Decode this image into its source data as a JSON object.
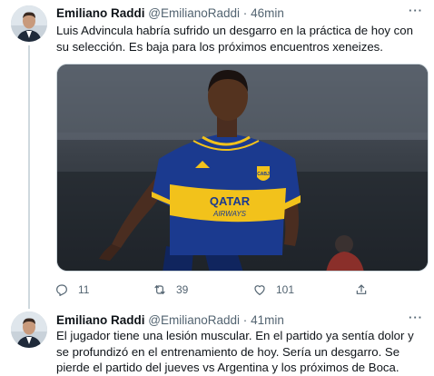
{
  "tweets": [
    {
      "name": "Emiliano Raddi",
      "handle": "@EmilianoRaddi",
      "separator": "·",
      "time": "46min",
      "more": "···",
      "text": "Luis Advincula habría sufrido un desgarro en la práctica de hoy con su selección. Es baja para los próximos encuentros xeneizes.",
      "media": {
        "jersey_sponsor_line1": "QATAR",
        "jersey_sponsor_line2": "AIRWAYS",
        "crest": "CABJ"
      },
      "replies": "11",
      "retweets": "39",
      "likes": "101"
    },
    {
      "name": "Emiliano Raddi",
      "handle": "@EmilianoRaddi",
      "separator": "·",
      "time": "41min",
      "more": "···",
      "text": "El jugador tiene una lesión muscular. En el partido ya sentía dolor y se profundizó en el entrenamiento de hoy. Sería un desgarro. Se pierde el partido del jueves vs Argentina y los próximos de Boca."
    }
  ],
  "icons": {
    "reply": "reply-icon",
    "retweet": "retweet-icon",
    "like": "heart-icon",
    "share": "share-icon",
    "more": "more-icon"
  },
  "colors": {
    "text": "#0f1419",
    "secondary": "#536471",
    "border": "#cfd9de",
    "jersey_blue": "#1b3a8f",
    "jersey_gold": "#f2c21b"
  }
}
